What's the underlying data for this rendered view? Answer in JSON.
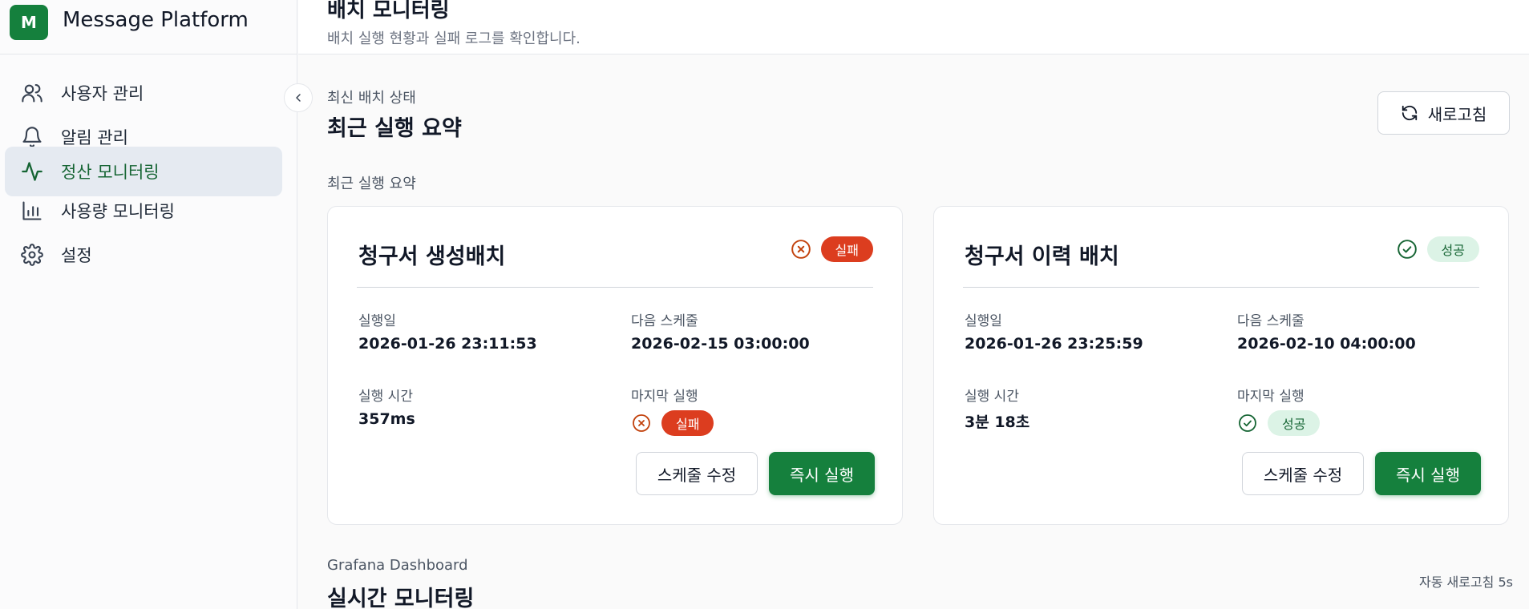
{
  "brand": {
    "logo_letter": "M",
    "name": "Message Platform"
  },
  "sidebar": {
    "items": [
      {
        "label": "사용자 관리",
        "icon": "users-icon",
        "active": false
      },
      {
        "label": "알림 관리",
        "icon": "bell-icon",
        "active": false
      },
      {
        "label": "정산 모니터링",
        "icon": "activity-icon",
        "active": true
      },
      {
        "label": "사용량 모니터링",
        "icon": "bar-chart-icon",
        "active": false
      },
      {
        "label": "설정",
        "icon": "gear-icon",
        "active": false
      }
    ]
  },
  "header": {
    "title": "배치 모니터링",
    "subtitle": "배치 실행 현황과 실패 로그를 확인합니다."
  },
  "latest": {
    "eyebrow": "최신 배치 상태",
    "title": "최근 실행 요약",
    "refresh_label": "새로고침",
    "summary_label": "최근 실행 요약"
  },
  "cards": [
    {
      "title": "청구서 생성배치",
      "status": "실패",
      "run_date_label": "실행일",
      "run_date": "2026-01-26 23:11:53",
      "next_schedule_label": "다음 스케줄",
      "next_schedule": "2026-02-15 03:00:00",
      "duration_label": "실행 시간",
      "duration": "357ms",
      "last_run_label": "마지막 실행",
      "last_run_status": "실패",
      "edit_schedule_label": "스케줄 수정",
      "run_now_label": "즉시 실행"
    },
    {
      "title": "청구서 이력 배치",
      "status": "성공",
      "run_date_label": "실행일",
      "run_date": "2026-01-26 23:25:59",
      "next_schedule_label": "다음 스케줄",
      "next_schedule": "2026-02-10 04:00:00",
      "duration_label": "실행 시간",
      "duration": "3분 18초",
      "last_run_label": "마지막 실행",
      "last_run_status": "성공",
      "edit_schedule_label": "스케줄 수정",
      "run_now_label": "즉시 실행"
    }
  ],
  "grafana": {
    "eyebrow": "Grafana Dashboard",
    "title": "실시간 모니터링",
    "auto_refresh": "자동 새로고침 5s"
  },
  "colors": {
    "primary": "#15803d",
    "fail": "#dc3d1f",
    "success_bg": "#dcf3e6",
    "active_nav_bg": "#e5eaf1"
  }
}
